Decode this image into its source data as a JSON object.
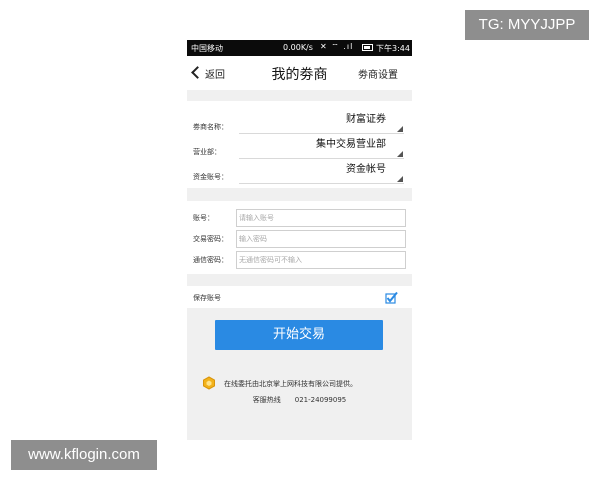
{
  "watermarks": {
    "top": "TG: MYYJJPP",
    "bottom": "www.kflogin.com"
  },
  "status_bar": {
    "carrier": "中国移动",
    "speed": "0.00K/s",
    "icons": "✕ ⌔ .ıl",
    "time": "下午3:44"
  },
  "nav": {
    "back_label": "返回",
    "title": "我的劵商",
    "settings_label": "劵商设置"
  },
  "broker_form": {
    "fields": [
      {
        "label": "劵商名称：",
        "value": "财富证券"
      },
      {
        "label": "营业部：",
        "value": "集中交易营业部"
      },
      {
        "label": "资金账号：",
        "value": "资金帐号"
      }
    ]
  },
  "login_form": {
    "account": {
      "label": "账号：",
      "placeholder": "请输入账号"
    },
    "trade_password": {
      "label": "交易密码：",
      "placeholder": "输入密码"
    },
    "comm_password": {
      "label": "通信密码：",
      "placeholder": "无通信密码可不输入"
    }
  },
  "save": {
    "label": "保存账号",
    "checked": true
  },
  "start_button": {
    "label": "开始交易"
  },
  "footer": {
    "provider_text": "在线委托由北京掌上网科技有限公司提供。",
    "hotline_label": "客服热线",
    "hotline_number": "021-24099095"
  },
  "colors": {
    "accent": "#2a8ae3",
    "background": "#f0f0f0",
    "status_bar": "#0b0b0b"
  }
}
